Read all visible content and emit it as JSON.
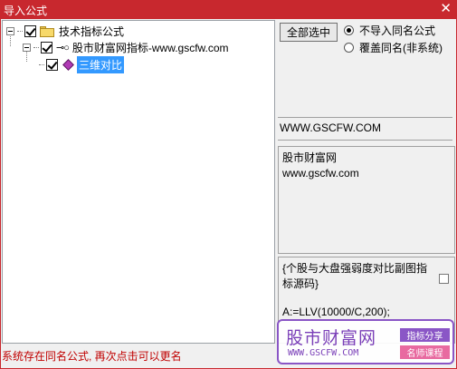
{
  "window": {
    "title": "导入公式",
    "close_glyph": "✕"
  },
  "tree": {
    "root": {
      "label": "技术指标公式",
      "checked": true
    },
    "child": {
      "label": "股市财富网指标-www.gscfw.com",
      "checked": true
    },
    "leaf": {
      "label": "三维对比",
      "checked": true,
      "selected": true
    }
  },
  "controls": {
    "select_all_label": "全部选中",
    "radio_skip_label": "不导入同名公式",
    "radio_overwrite_label": "覆盖同名(非系统)"
  },
  "info": {
    "url": "WWW.GSCFW.COM",
    "line1": "股市财富网",
    "line2": "www.gscfw.com"
  },
  "code": {
    "line1": "{个股与大盘强弱度对比副图指标源码}",
    "line2": "A:=LLV(10000/C,200);"
  },
  "status": "系统存在同名公式, 再次点击可以更名",
  "watermark": {
    "brand": "股市财富网",
    "site": "WWW.GSCFW.COM",
    "badge1": "指标分享",
    "badge2": "名师课程"
  }
}
